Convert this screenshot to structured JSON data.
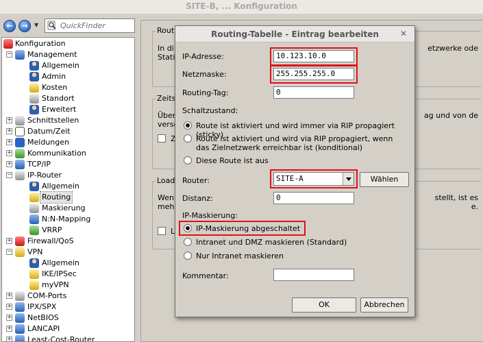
{
  "window": {
    "title": "SITE-B, ... Konfiguration"
  },
  "toolbar": {
    "quickfinder_placeholder": "QuickFinder"
  },
  "tree": {
    "items": [
      {
        "label": "Konfiguration",
        "icon": "wrench-icon"
      },
      {
        "label": "Management",
        "icon": "management-icon"
      },
      {
        "label": "Allgemein",
        "icon": "person-icon"
      },
      {
        "label": "Admin",
        "icon": "person-icon"
      },
      {
        "label": "Kosten",
        "icon": "coins-icon"
      },
      {
        "label": "Standort",
        "icon": "location-icon"
      },
      {
        "label": "Erweitert",
        "icon": "person-icon"
      },
      {
        "label": "Schnittstellen",
        "icon": "interfaces-icon"
      },
      {
        "label": "Datum/Zeit",
        "icon": "clock-icon"
      },
      {
        "label": "Meldungen",
        "icon": "info-icon"
      },
      {
        "label": "Kommunikation",
        "icon": "communication-icon"
      },
      {
        "label": "TCP/IP",
        "icon": "network-icon"
      },
      {
        "label": "IP-Router",
        "icon": "router-icon"
      },
      {
        "label": "Allgemein",
        "icon": "person-icon"
      },
      {
        "label": "Routing",
        "icon": "routing-icon"
      },
      {
        "label": "Maskierung",
        "icon": "masking-icon"
      },
      {
        "label": "N:N-Mapping",
        "icon": "mapping-icon"
      },
      {
        "label": "VRRP",
        "icon": "vrrp-icon"
      },
      {
        "label": "Firewall/QoS",
        "icon": "firewall-icon"
      },
      {
        "label": "VPN",
        "icon": "lock-icon"
      },
      {
        "label": "Allgemein",
        "icon": "person-icon"
      },
      {
        "label": "IKE/IPSec",
        "icon": "key-icon"
      },
      {
        "label": "myVPN",
        "icon": "key-icon"
      },
      {
        "label": "COM-Ports",
        "icon": "com-icon"
      },
      {
        "label": "IPX/SPX",
        "icon": "network-icon"
      },
      {
        "label": "NetBIOS",
        "icon": "network-icon"
      },
      {
        "label": "LANCAPI",
        "icon": "network-icon"
      },
      {
        "label": "Least-Cost-Router",
        "icon": "network-icon"
      }
    ]
  },
  "background": {
    "group1": {
      "title": "Routi",
      "line1": "In di",
      "line1_right": "etzwerke ode",
      "line2": "Statio"
    },
    "group2": {
      "title": "Zeits",
      "line1": "Über",
      "line1_right": "ag und von de",
      "line2": "verso",
      "checkbox_label": "Z"
    },
    "group3": {
      "title": "Load-",
      "line1": "Wenn",
      "line1_right": "stellt, ist es",
      "line2": "mehr",
      "line2_right": "e.",
      "checkbox_label": "L"
    }
  },
  "dialog": {
    "title": "Routing-Tabelle - Eintrag bearbeiten",
    "ip_label": "IP-Adresse:",
    "ip_value": "10.123.10.0",
    "mask_label": "Netzmaske:",
    "mask_value": "255.255.255.0",
    "tag_label": "Routing-Tag:",
    "tag_value": "0",
    "state_label": "Schaltzustand:",
    "state_opt1": "Route ist aktiviert und wird immer via RIP propagiert (sticky)",
    "state_opt2": "Route ist aktiviert und wird via RIP propagiert, wenn das Zielnetzwerk erreichbar ist (konditional)",
    "state_opt3": "Diese Route ist aus",
    "router_label": "Router:",
    "router_value": "SITE-A",
    "choose_button": "Wählen",
    "distance_label": "Distanz:",
    "distance_value": "0",
    "masking_label": "IP-Maskierung:",
    "mask_opt1": "IP-Maskierung abgeschaltet",
    "mask_opt2": "Intranet und DMZ maskieren (Standard)",
    "mask_opt3": "Nur Intranet maskieren",
    "comment_label": "Kommentar:",
    "comment_value": "",
    "ok_button": "OK",
    "cancel_button": "Abbrechen"
  },
  "colors": {
    "highlight": "#e0101a",
    "dialog_bg": "#d4d0c8"
  }
}
